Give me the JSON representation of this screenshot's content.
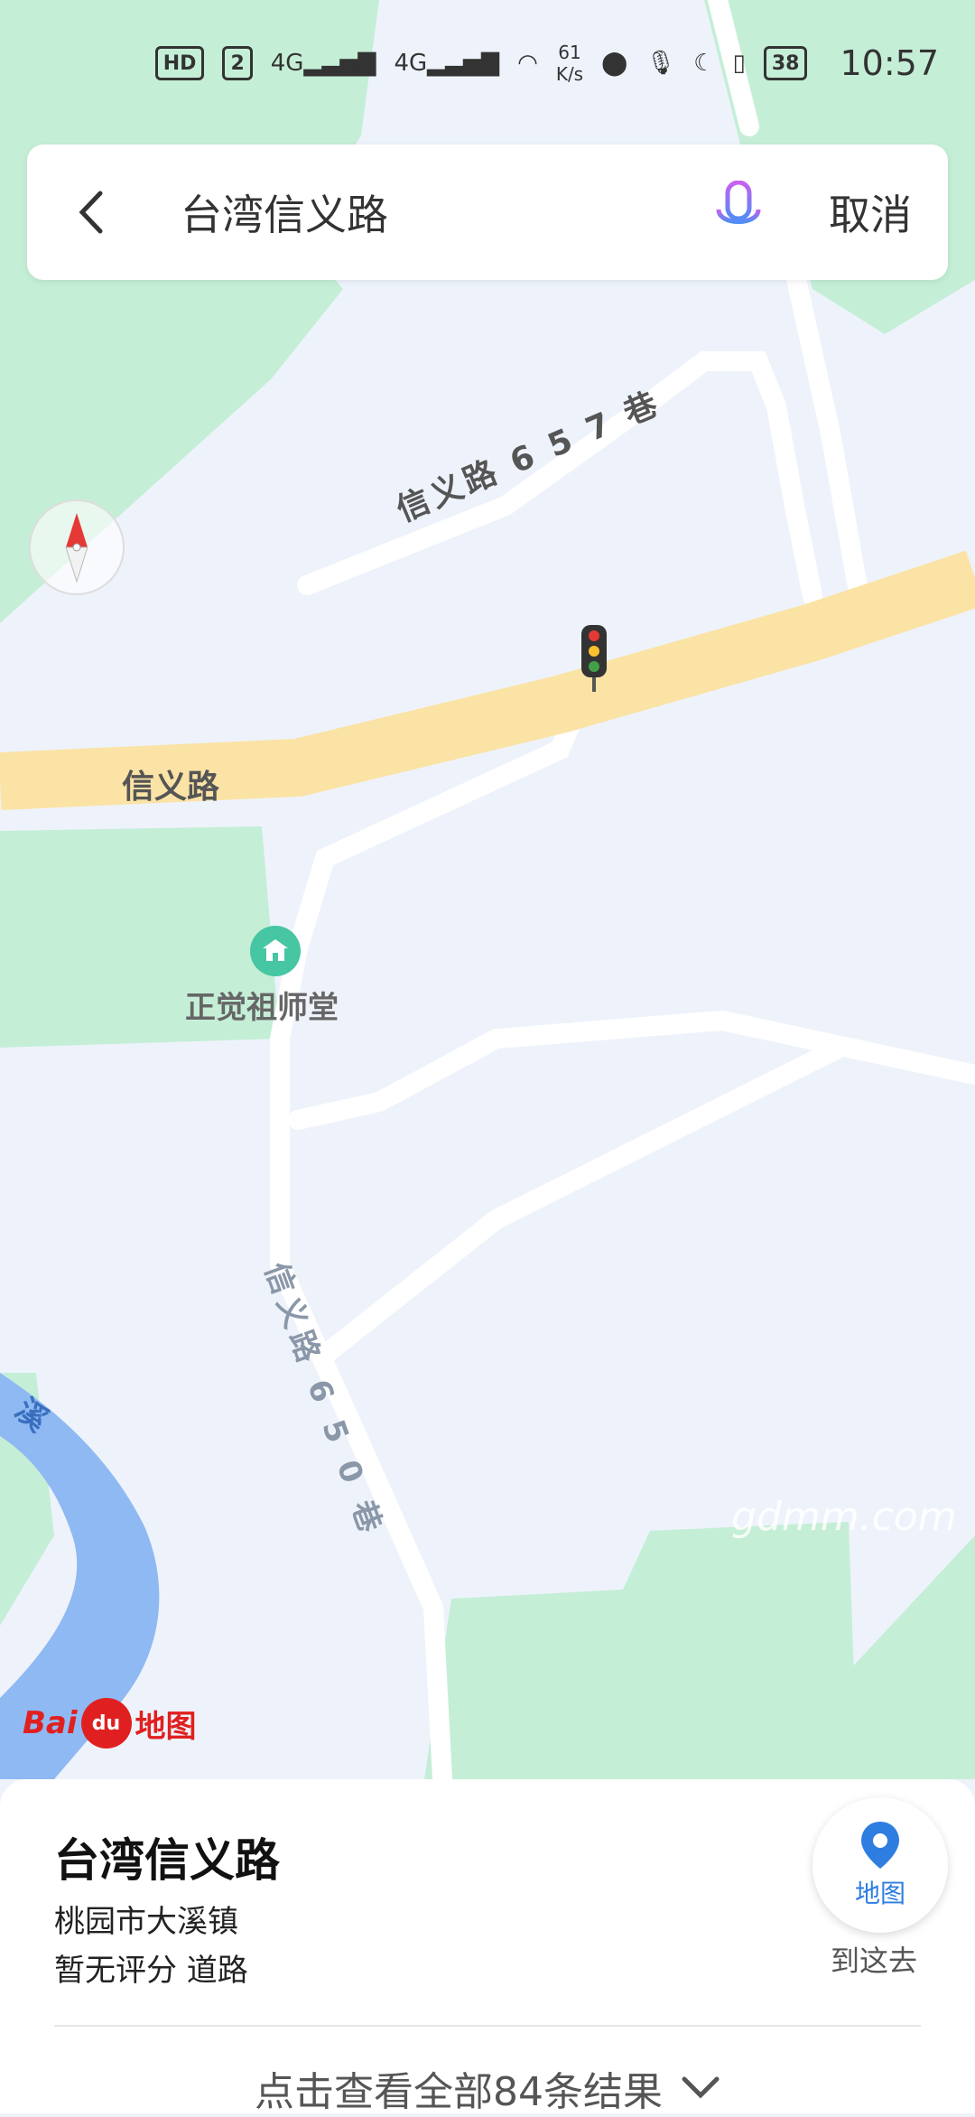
{
  "status_bar": {
    "hd": "HD",
    "sim": "2",
    "net1": "4G",
    "net2": "4G",
    "speed_value": "61",
    "speed_unit": "K/s",
    "battery": "38",
    "time": "10:57"
  },
  "search": {
    "query": "台湾信义路",
    "cancel_label": "取消",
    "back_icon": "chevron-left-icon",
    "mic_icon": "microphone-icon"
  },
  "map": {
    "road_main": "信义路",
    "road_lane_657": "信义路 6 5 7 巷",
    "road_lane_650": "信义路 6 5 0 巷",
    "river_label": "溪",
    "poi_name": "正觉祖师堂",
    "logo_text_bai": "Bai",
    "logo_text_du": "du",
    "logo_text_map": "地图",
    "colors": {
      "background": "#eef3fb",
      "green_area": "#c5eed7",
      "main_road": "#fbe3a6",
      "river": "#8fb9f2",
      "minor_road": "#ffffff"
    }
  },
  "bottom_card": {
    "title": "台湾信义路",
    "address": "桃园市大溪镇",
    "meta": "暂无评分 道路",
    "map_button_label": "地图",
    "goto_label": "到这去",
    "view_all": "点击查看全部84条结果"
  },
  "watermark": "gdmm.com"
}
